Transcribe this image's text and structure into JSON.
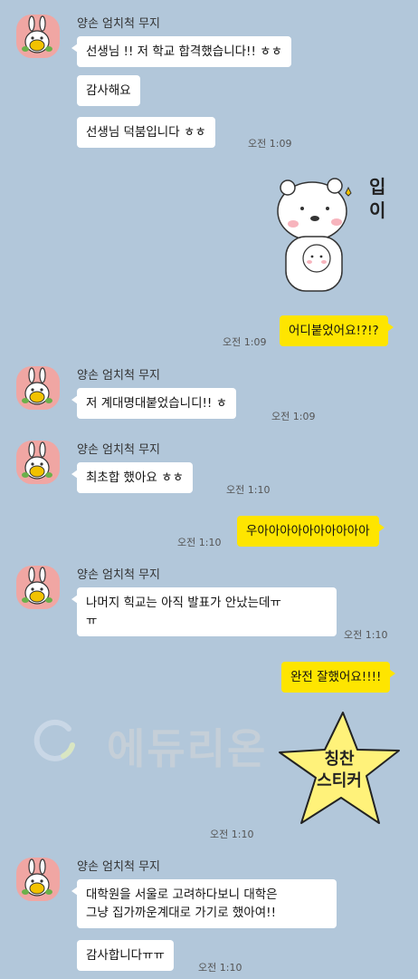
{
  "colors": {
    "background": "#b2c7da",
    "my_bubble": "#fee500",
    "their_bubble": "#ffffff",
    "avatar_bg": "#f0a6a3"
  },
  "sender_name": "양손 엄치척 무지",
  "messages": {
    "m1": "선생님 !! 저 학교 합격했습니다!! ㅎㅎ",
    "m2": "감사해요",
    "m3": "선생님 덕붐입니다 ㅎㅎ",
    "m3_time": "오전 1:09",
    "sticker1_text_line1": "입",
    "sticker1_text_line2": "이",
    "m4": "어디붙었어요!?!?",
    "m4_time": "오전 1:09",
    "m5": "저 계대명대붙었습니디!! ㅎ",
    "m5_time": "오전 1:09",
    "m6": "최초합 했아요 ㅎㅎ",
    "m6_time": "오전 1:10",
    "m7": "우아아아아아아아아아아",
    "m7_time": "오전 1:10",
    "m8_line1": "나머지 힉교는 아직 발표가 안났는데ㅠ",
    "m8_line2": "ㅠ",
    "m8_time": "오전 1:10",
    "m9": "완전 잘했어요!!!!",
    "watermark": "에듀리온",
    "sticker2_line1": "칭찬",
    "sticker2_line2": "스티커",
    "sticker2_time": "오전 1:10",
    "m10_line1": "대학원을 서울로 고려하다보니 대학은",
    "m10_line2": "그냥 집가까운계대로 가기로 했아여!!",
    "m11": "감사합니다ㅠㅠ",
    "m11_time": "오전 1:10"
  }
}
